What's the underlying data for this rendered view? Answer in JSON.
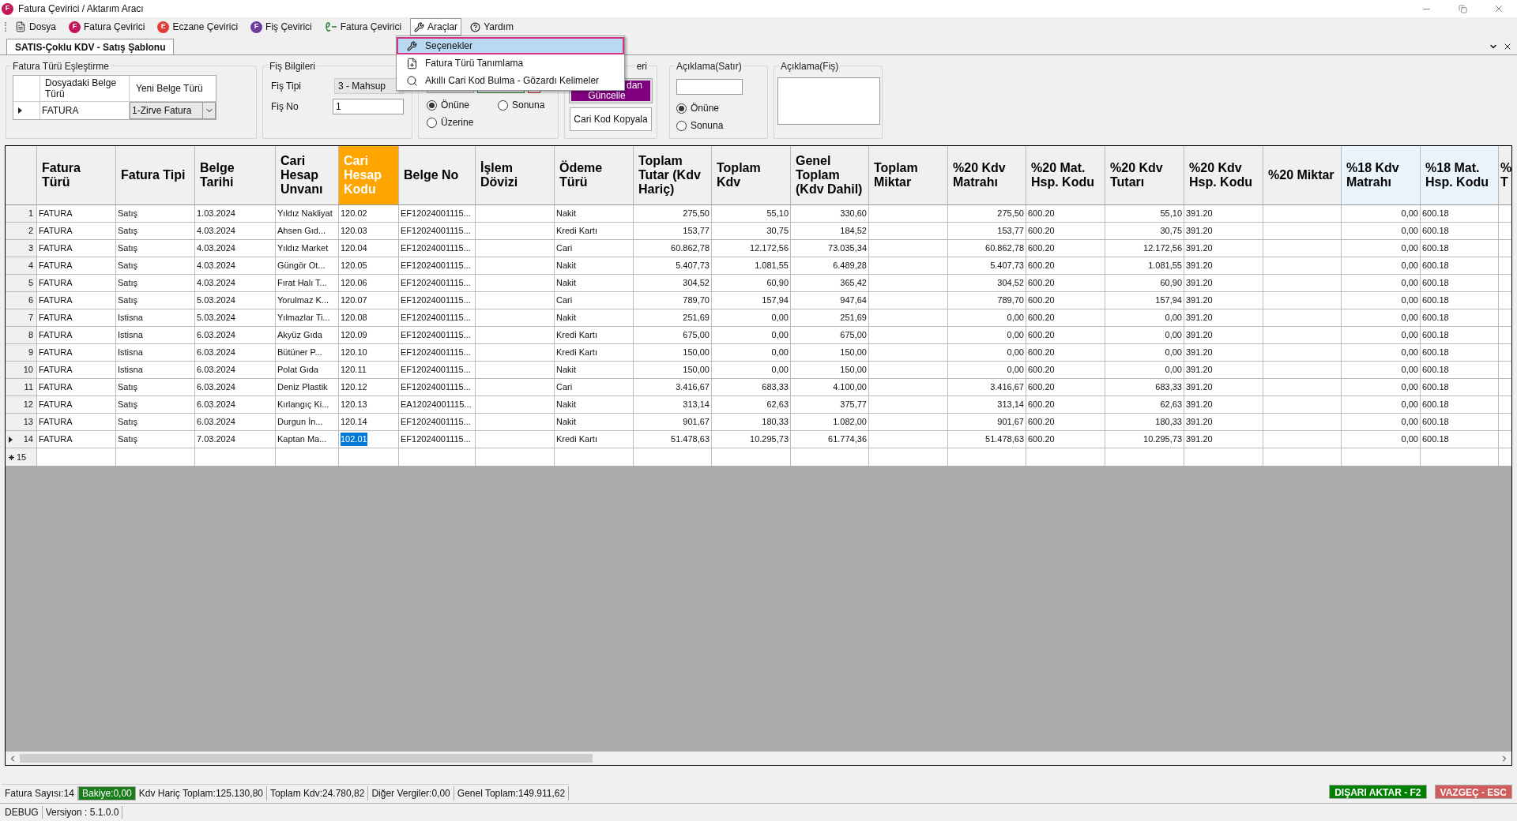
{
  "window": {
    "icon_letter": "F",
    "title": "Fatura Çevirici / Aktarım Aracı"
  },
  "menu": [
    {
      "kind": "doc",
      "label": "Dosya",
      "open": false
    },
    {
      "kind": "badge",
      "badge": "F",
      "color": "#c2185b",
      "label": "Fatura Çevirici",
      "open": false
    },
    {
      "kind": "badge",
      "badge": "E",
      "color": "#e53935",
      "label": "Eczane Çevirici",
      "open": false
    },
    {
      "kind": "badge",
      "badge": "F",
      "color": "#6a3d9a",
      "label": "Fiş Çevirici",
      "open": false
    },
    {
      "kind": "efatura",
      "label": "Fatura Çevirici",
      "open": false
    },
    {
      "kind": "tools",
      "label": "Araçlar",
      "open": true
    },
    {
      "kind": "help",
      "label": "Yardım",
      "open": false
    }
  ],
  "dropdown": [
    {
      "kind": "tools",
      "label": "Seçenekler",
      "selected": true
    },
    {
      "kind": "file-plus",
      "label": "Fatura Türü Tanımlama",
      "selected": false
    },
    {
      "kind": "search",
      "label": "Akıllı Cari Kod Bulma - Gözardı Kelimeler",
      "selected": false
    }
  ],
  "tab": {
    "label": "SATIS-Çoklu KDV - Satış Şablonu"
  },
  "mapping": {
    "title": "Fatura Türü Eşleştirme",
    "columns": [
      "Dosyadaki Belge Türü",
      "Yeni Belge Türü"
    ],
    "row": {
      "current": true,
      "source": "FATURA",
      "target": "1-Zirve Fatura"
    }
  },
  "fis": {
    "title": "Fiş Bilgileri",
    "type_label": "Fiş Tipi",
    "type_value": "3 - Mahsup",
    "no_label": "Fiş No",
    "no_value": "1"
  },
  "position": {
    "options": [
      {
        "label": "Önüne",
        "selected": true
      },
      {
        "label": "Sonuna",
        "selected": false
      },
      {
        "label": "Üzerine",
        "selected": false
      }
    ]
  },
  "codes": {
    "title": "eri",
    "update_button": [
      "dan",
      "Güncelle"
    ],
    "copy_button": "Cari Kod Kopyala"
  },
  "line_note": {
    "title": "Açıklama(Satır)",
    "options": [
      {
        "label": "Önüne",
        "selected": true
      },
      {
        "label": "Sonuna",
        "selected": false
      }
    ]
  },
  "slip_note": {
    "title": "Açıklama(Fiş)"
  },
  "table": {
    "columns": [
      {
        "label": "Fatura Türü",
        "kind": "text",
        "current": false
      },
      {
        "label": "Fatura Tipi",
        "kind": "text",
        "current": false
      },
      {
        "label": "Belge Tarihi",
        "kind": "text",
        "current": false
      },
      {
        "label": "Cari Hesap Unvanı",
        "kind": "text",
        "current": false
      },
      {
        "label": "Cari Hesap Kodu",
        "kind": "text",
        "current": true,
        "color": "#ffa500"
      },
      {
        "label": "Belge No",
        "kind": "text",
        "current": false
      },
      {
        "label": "İşlem Dövizi",
        "kind": "text",
        "current": false
      },
      {
        "label": "Ödeme Türü",
        "kind": "text",
        "current": false
      },
      {
        "label": "Toplam Tutar (Kdv Hariç)",
        "kind": "number",
        "current": false
      },
      {
        "label": "Toplam Kdv",
        "kind": "number",
        "current": false
      },
      {
        "label": "Genel Toplam (Kdv Dahil)",
        "kind": "number",
        "current": false
      },
      {
        "label": "Toplam Miktar",
        "kind": "number",
        "current": false
      },
      {
        "label": "%20 Kdv Matrahı",
        "kind": "number",
        "current": false
      },
      {
        "label": "%20 Mat. Hsp. Kodu",
        "kind": "text",
        "current": false
      },
      {
        "label": "%20 Kdv Tutarı",
        "kind": "number",
        "current": false
      },
      {
        "label": "%20 Kdv Hsp. Kodu",
        "kind": "text",
        "current": false
      },
      {
        "label": "%20 Miktar",
        "kind": "number",
        "current": false
      },
      {
        "label": "%18 Kdv Matrahı",
        "kind": "number",
        "current": false,
        "color": "#eaf4fd"
      },
      {
        "label": "%18 Mat. Hsp. Kodu",
        "kind": "text",
        "current": false,
        "color": "#eaf4fd"
      },
      {
        "label": "% T",
        "kind": "text",
        "current": false
      }
    ],
    "rows": [
      {
        "number": "1",
        "current": false,
        "cells": [
          "FATURA",
          "Satış",
          "1.03.2024",
          "Yıldız Nakliyat",
          "120.02",
          "EF12024001115...",
          null,
          "Nakit",
          "275,50",
          "55,10",
          "330,60",
          null,
          "275,50",
          "600.20",
          "55,10",
          "391.20",
          null,
          "0,00",
          "600.18"
        ]
      },
      {
        "number": "2",
        "current": false,
        "cells": [
          "FATURA",
          "Satış",
          "4.03.2024",
          "Ahsen Gıd...",
          "120.03",
          "EF12024001115...",
          null,
          "Kredi Kartı",
          "153,77",
          "30,75",
          "184,52",
          null,
          "153,77",
          "600.20",
          "30,75",
          "391.20",
          null,
          "0,00",
          "600.18"
        ]
      },
      {
        "number": "3",
        "current": false,
        "cells": [
          "FATURA",
          "Satış",
          "4.03.2024",
          "Yıldız Market",
          "120.04",
          "EF12024001115...",
          null,
          "Cari",
          "60.862,78",
          "12.172,56",
          "73.035,34",
          null,
          "60.862,78",
          "600.20",
          "12.172,56",
          "391.20",
          null,
          "0,00",
          "600.18"
        ]
      },
      {
        "number": "4",
        "current": false,
        "cells": [
          "FATURA",
          "Satış",
          "4.03.2024",
          "Güngör Ot...",
          "120.05",
          "EF12024001115...",
          null,
          "Nakit",
          "5.407,73",
          "1.081,55",
          "6.489,28",
          null,
          "5.407,73",
          "600.20",
          "1.081,55",
          "391.20",
          null,
          "0,00",
          "600.18"
        ]
      },
      {
        "number": "5",
        "current": false,
        "cells": [
          "FATURA",
          "Satış",
          "4.03.2024",
          "Fırat Halı T...",
          "120.06",
          "EF12024001115...",
          null,
          "Nakit",
          "304,52",
          "60,90",
          "365,42",
          null,
          "304,52",
          "600.20",
          "60,90",
          "391.20",
          null,
          "0,00",
          "600.18"
        ]
      },
      {
        "number": "6",
        "current": false,
        "cells": [
          "FATURA",
          "Satış",
          "5.03.2024",
          "Yorulmaz K...",
          "120.07",
          "EF12024001115...",
          null,
          "Cari",
          "789,70",
          "157,94",
          "947,64",
          null,
          "789,70",
          "600.20",
          "157,94",
          "391.20",
          null,
          "0,00",
          "600.18"
        ]
      },
      {
        "number": "7",
        "current": false,
        "cells": [
          "FATURA",
          "Istisna",
          "5.03.2024",
          "Yılmazlar Ti...",
          "120.08",
          "EF12024001115...",
          null,
          "Nakit",
          "251,69",
          "0,00",
          "251,69",
          null,
          "0,00",
          "600.20",
          "0,00",
          "391.20",
          null,
          "0,00",
          "600.18"
        ]
      },
      {
        "number": "8",
        "current": false,
        "cells": [
          "FATURA",
          "Istisna",
          "6.03.2024",
          "Akyüz Gıda",
          "120.09",
          "EF12024001115...",
          null,
          "Kredi Kartı",
          "675,00",
          "0,00",
          "675,00",
          null,
          "0,00",
          "600.20",
          "0,00",
          "391.20",
          null,
          "0,00",
          "600.18"
        ]
      },
      {
        "number": "9",
        "current": false,
        "cells": [
          "FATURA",
          "Istisna",
          "6.03.2024",
          "Bütüner P...",
          "120.10",
          "EF12024001115...",
          null,
          "Kredi Kartı",
          "150,00",
          "0,00",
          "150,00",
          null,
          "0,00",
          "600.20",
          "0,00",
          "391.20",
          null,
          "0,00",
          "600.18"
        ]
      },
      {
        "number": "10",
        "current": false,
        "cells": [
          "FATURA",
          "Istisna",
          "6.03.2024",
          "Polat Gıda",
          "120.11",
          "EF12024001115...",
          null,
          "Nakit",
          "150,00",
          "0,00",
          "150,00",
          null,
          "0,00",
          "600.20",
          "0,00",
          "391.20",
          null,
          "0,00",
          "600.18"
        ]
      },
      {
        "number": "11",
        "current": false,
        "cells": [
          "FATURA",
          "Satış",
          "6.03.2024",
          "Deniz Plastik",
          "120.12",
          "EF12024001115...",
          null,
          "Cari",
          "3.416,67",
          "683,33",
          "4.100,00",
          null,
          "3.416,67",
          "600.20",
          "683,33",
          "391.20",
          null,
          "0,00",
          "600.18"
        ]
      },
      {
        "number": "12",
        "current": false,
        "cells": [
          "FATURA",
          "Satış",
          "6.03.2024",
          "Kırlangıç Ki...",
          "120.13",
          "EA12024001115...",
          null,
          "Nakit",
          "313,14",
          "62,63",
          "375,77",
          null,
          "313,14",
          "600.20",
          "62,63",
          "391.20",
          null,
          "0,00",
          "600.18"
        ]
      },
      {
        "number": "13",
        "current": false,
        "cells": [
          "FATURA",
          "Satış",
          "6.03.2024",
          "Durgun İn...",
          "120.14",
          "EF12024001115...",
          null,
          "Nakit",
          "901,67",
          "180,33",
          "1.082,00",
          null,
          "901,67",
          "600.20",
          "180,33",
          "391.20",
          null,
          "0,00",
          "600.18"
        ]
      },
      {
        "number": "14",
        "current": true,
        "cells": [
          "FATURA",
          "Satış",
          "7.03.2024",
          "Kaptan Ma...",
          "102.01",
          "EF12024001115...",
          null,
          "Kredi Kartı",
          "51.478,63",
          "10.295,73",
          "61.774,36",
          null,
          "51.478,63",
          "600.20",
          "10.295,73",
          "391.20",
          null,
          "0,00",
          "600.18"
        ]
      }
    ],
    "new_row": {
      "number": "15"
    }
  },
  "status_bar": [
    {
      "label": "Fatura Sayısı:14",
      "highlighted": false
    },
    {
      "label": "Bakiye:0,00",
      "highlighted": true
    },
    {
      "label": "Kdv Hariç Toplam:125.130,80",
      "highlighted": false
    },
    {
      "label": "Toplam Kdv:24.780,82",
      "highlighted": false
    },
    {
      "label": "Diğer Vergiler:0,00",
      "highlighted": false
    },
    {
      "label": "Genel Toplam:149.911,62",
      "highlighted": false
    }
  ],
  "buttons": [
    {
      "kind": "export",
      "label": "DIŞARI AKTAR - F2"
    },
    {
      "kind": "cancel",
      "label": "VAZGEÇ - ESC"
    }
  ],
  "footer": [
    "DEBUG",
    "Versiyon : 5.1.0.0"
  ]
}
